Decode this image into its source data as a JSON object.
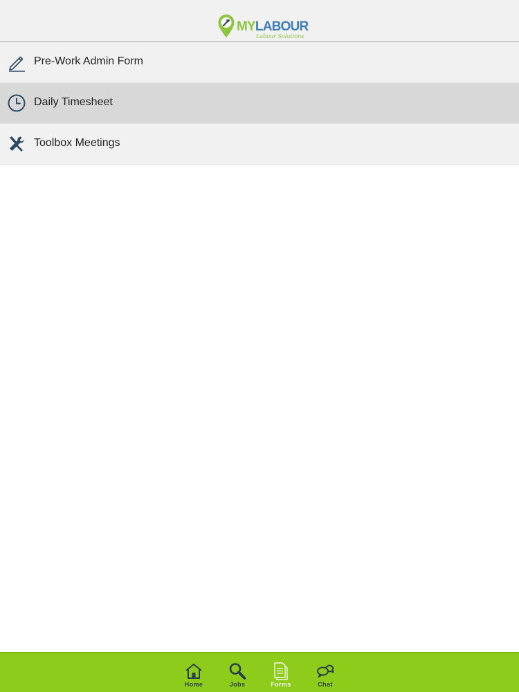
{
  "header": {
    "logo_text_my": "MY",
    "logo_text_labour": "LABOUR",
    "logo_tagline": "Labour Solutions"
  },
  "menu": {
    "items": [
      {
        "label": "Pre-Work Admin Form",
        "icon": "pencil-icon",
        "selected": false
      },
      {
        "label": "Daily Timesheet",
        "icon": "clock-icon",
        "selected": true
      },
      {
        "label": "Toolbox Meetings",
        "icon": "tools-icon",
        "selected": false
      }
    ]
  },
  "tabbar": {
    "tabs": [
      {
        "label": "Home",
        "icon": "home-icon",
        "active": false
      },
      {
        "label": "Jobs",
        "icon": "search-icon",
        "active": false
      },
      {
        "label": "Forms",
        "icon": "document-icon",
        "active": true
      },
      {
        "label": "Chat",
        "icon": "chat-bubbles-icon",
        "active": false
      }
    ]
  },
  "colors": {
    "brand_green": "#8dcc1b",
    "brand_blue": "#3f7db7",
    "icon_dark": "#2d4a63",
    "selected_row": "#d8d8d8"
  }
}
